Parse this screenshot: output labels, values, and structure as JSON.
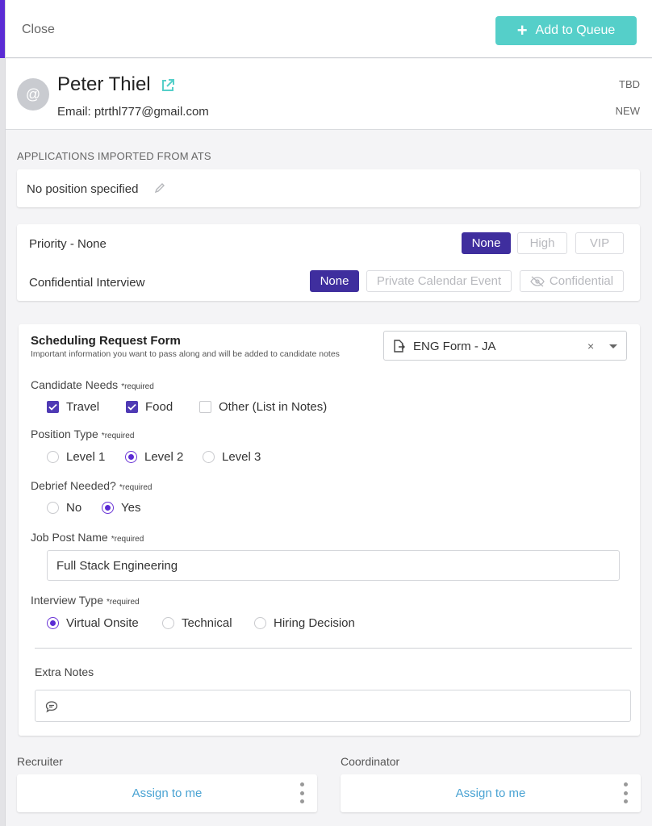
{
  "header": {
    "close_label": "Close",
    "queue_label": "Add to Queue"
  },
  "candidate": {
    "avatar": "@",
    "name": "Peter Thiel",
    "email": "Email: ptrthl777@gmail.com",
    "tag": "TBD",
    "status": "NEW"
  },
  "applications": {
    "section_label": "APPLICATIONS IMPORTED FROM ATS",
    "position": "No position specified"
  },
  "priority": {
    "label": "Priority - None",
    "options": [
      "None",
      "High",
      "VIP"
    ],
    "selected": "None"
  },
  "confidential": {
    "label": "Confidential Interview",
    "options": [
      "None",
      "Private Calendar Event",
      "Confidential"
    ],
    "selected": "None"
  },
  "form": {
    "title": "Scheduling Request Form",
    "subtitle": "Important information you want to pass along and will be added to candidate notes",
    "selected_form": "ENG Form - JA",
    "clear_glyph": "×",
    "required_marker": "*required",
    "candidate_needs": {
      "label": "Candidate Needs",
      "options": [
        {
          "label": "Travel",
          "checked": true
        },
        {
          "label": "Food",
          "checked": true
        },
        {
          "label": "Other (List in Notes)",
          "checked": false
        }
      ]
    },
    "position_type": {
      "label": "Position Type",
      "options": [
        "Level 1",
        "Level 2",
        "Level 3"
      ],
      "selected": "Level 2"
    },
    "debrief": {
      "label": "Debrief Needed?",
      "options": [
        "No",
        "Yes"
      ],
      "selected": "Yes"
    },
    "job_post": {
      "label": "Job Post Name",
      "value": "Full Stack Engineering"
    },
    "interview_type": {
      "label": "Interview Type",
      "options": [
        "Virtual Onsite",
        "Technical",
        "Hiring Decision"
      ],
      "selected": "Virtual Onsite"
    },
    "extra_notes": {
      "label": "Extra Notes",
      "value": ""
    }
  },
  "assignees": {
    "recruiter": {
      "label": "Recruiter",
      "action": "Assign to me"
    },
    "coordinator": {
      "label": "Coordinator",
      "action": "Assign to me"
    }
  },
  "colors": {
    "accent": "#3f2e9e",
    "queue_button": "#55cfc9",
    "link": "#4aa3d3",
    "radio": "#5b2bd4"
  },
  "icons": [
    "plus-icon",
    "external-link-icon",
    "pencil-icon",
    "eye-slash-icon",
    "document-export-icon",
    "chevron-down-icon",
    "chat-icon",
    "kebab-menu-icon"
  ]
}
